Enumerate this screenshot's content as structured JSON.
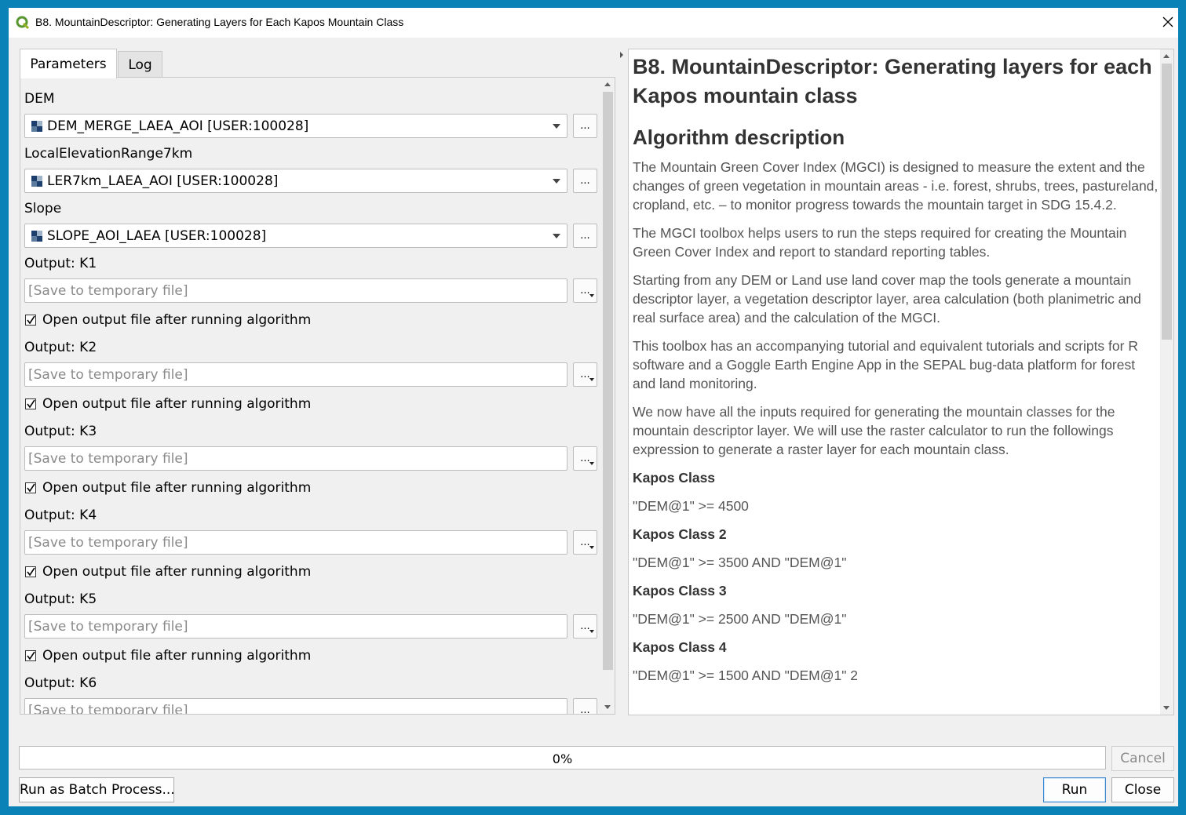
{
  "window": {
    "title": "B8. MountainDescriptor: Generating Layers for Each Kapos Mountain Class"
  },
  "tabs": [
    {
      "label": "Parameters",
      "active": true
    },
    {
      "label": "Log",
      "active": false
    }
  ],
  "params": {
    "dem": {
      "label": "DEM",
      "value": "DEM_MERGE_LAEA_AOI [USER:100028]"
    },
    "ler": {
      "label": "LocalElevationRange7km",
      "value": "LER7km_LAEA_AOI [USER:100028]"
    },
    "slope": {
      "label": "Slope",
      "value": "SLOPE_AOI_LAEA [USER:100028]"
    },
    "browse_label": "...",
    "outputs": [
      {
        "label": "Output: K1",
        "placeholder": "[Save to temporary file]",
        "open_after": "Open output file after running algorithm",
        "checked": true
      },
      {
        "label": "Output: K2",
        "placeholder": "[Save to temporary file]",
        "open_after": "Open output file after running algorithm",
        "checked": true
      },
      {
        "label": "Output: K3",
        "placeholder": "[Save to temporary file]",
        "open_after": "Open output file after running algorithm",
        "checked": true
      },
      {
        "label": "Output: K4",
        "placeholder": "[Save to temporary file]",
        "open_after": "Open output file after running algorithm",
        "checked": true
      },
      {
        "label": "Output: K5",
        "placeholder": "[Save to temporary file]",
        "open_after": "Open output file after running algorithm",
        "checked": true
      },
      {
        "label": "Output: K6",
        "placeholder": "[Save to temporary file]"
      }
    ]
  },
  "help": {
    "title": "B8. MountainDescriptor: Generating layers for each Kapos mountain class",
    "section": "Algorithm description",
    "paragraphs": [
      "The Mountain Green Cover Index (MGCI) is designed to measure the extent and the changes of green vegetation in mountain areas - i.e. forest, shrubs, trees, pastureland, cropland, etc. – to monitor progress towards the mountain target in SDG 15.4.2.",
      "The MGCI toolbox helps users to run the steps required for creating the Mountain Green Cover Index and report to standard reporting tables.",
      "Starting from any DEM or Land use land cover map the tools generate a mountain descriptor layer, a vegetation descriptor layer, area calculation (both planimetric and real surface area) and the calculation of the MGCI.",
      "This toolbox has an accompanying tutorial and equivalent tutorials and scripts for R software and a Goggle Earth Engine App in the SEPAL bug-data platform for forest and land monitoring.",
      "We now have all the inputs required for generating the mountain classes for the mountain descriptor layer. We will use the raster calculator to run the followings expression to generate a raster layer for each mountain class."
    ],
    "classes": [
      {
        "heading": "Kapos Class",
        "expr": "\"DEM@1\" >= 4500"
      },
      {
        "heading": "Kapos Class 2",
        "expr": "\"DEM@1\" >= 3500 AND \"DEM@1\""
      },
      {
        "heading": "Kapos Class 3",
        "expr": "\"DEM@1\" >= 2500 AND \"DEM@1\""
      },
      {
        "heading": "Kapos Class 4",
        "expr": "\"DEM@1\" >= 1500 AND \"DEM@1\" 2"
      }
    ]
  },
  "progress": {
    "text": "0%",
    "value": 0
  },
  "buttons": {
    "cancel": "Cancel",
    "batch": "Run as Batch Process...",
    "run": "Run",
    "close": "Close"
  }
}
